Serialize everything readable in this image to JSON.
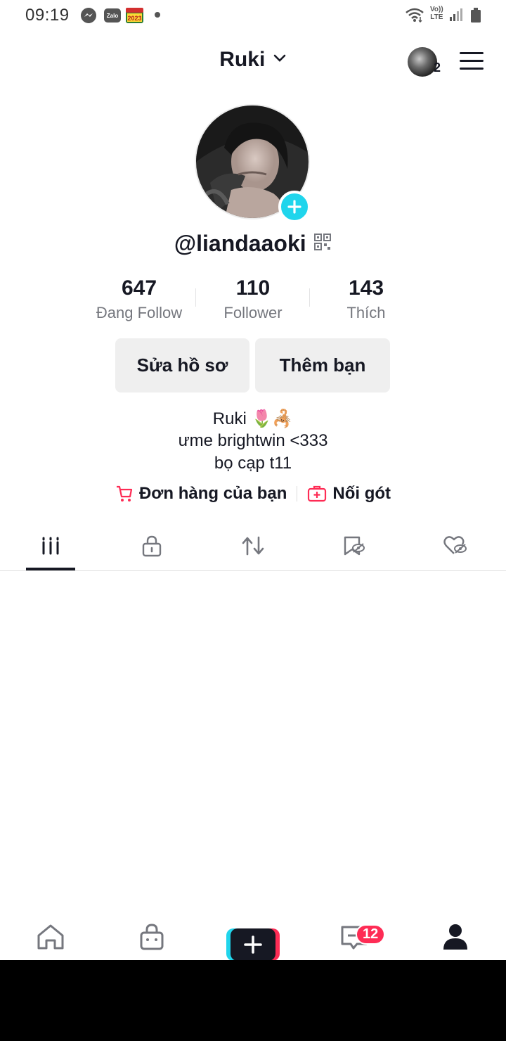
{
  "status_bar": {
    "time": "09:19",
    "zalo_label": "Zalo",
    "calendar_label": "2023",
    "volte_top": "Vo))",
    "volte_bottom": "LTE"
  },
  "header": {
    "title": "Ruki",
    "account_badge": "2"
  },
  "profile": {
    "username": "@liandaaoki"
  },
  "stats": [
    {
      "value": "647",
      "label": "Đang Follow"
    },
    {
      "value": "110",
      "label": "Follower"
    },
    {
      "value": "143",
      "label": "Thích"
    }
  ],
  "actions": {
    "edit_profile": "Sửa hồ sơ",
    "add_friends": "Thêm bạn"
  },
  "bio": {
    "line1": "Ruki 🌷🦂",
    "line2": "ưme brightwin <333",
    "line3": "bọ cạp t11"
  },
  "links": {
    "orders": "Đơn hàng của bạn",
    "pin": "Nối gót"
  },
  "tabs": [
    "videos",
    "private",
    "reposts",
    "favorites",
    "liked"
  ],
  "bottom_nav": {
    "inbox_badge": "12"
  },
  "colors": {
    "accent_cyan": "#20d5ec",
    "accent_red": "#fe2c55",
    "text_primary": "#161823",
    "text_secondary": "#75777e"
  }
}
